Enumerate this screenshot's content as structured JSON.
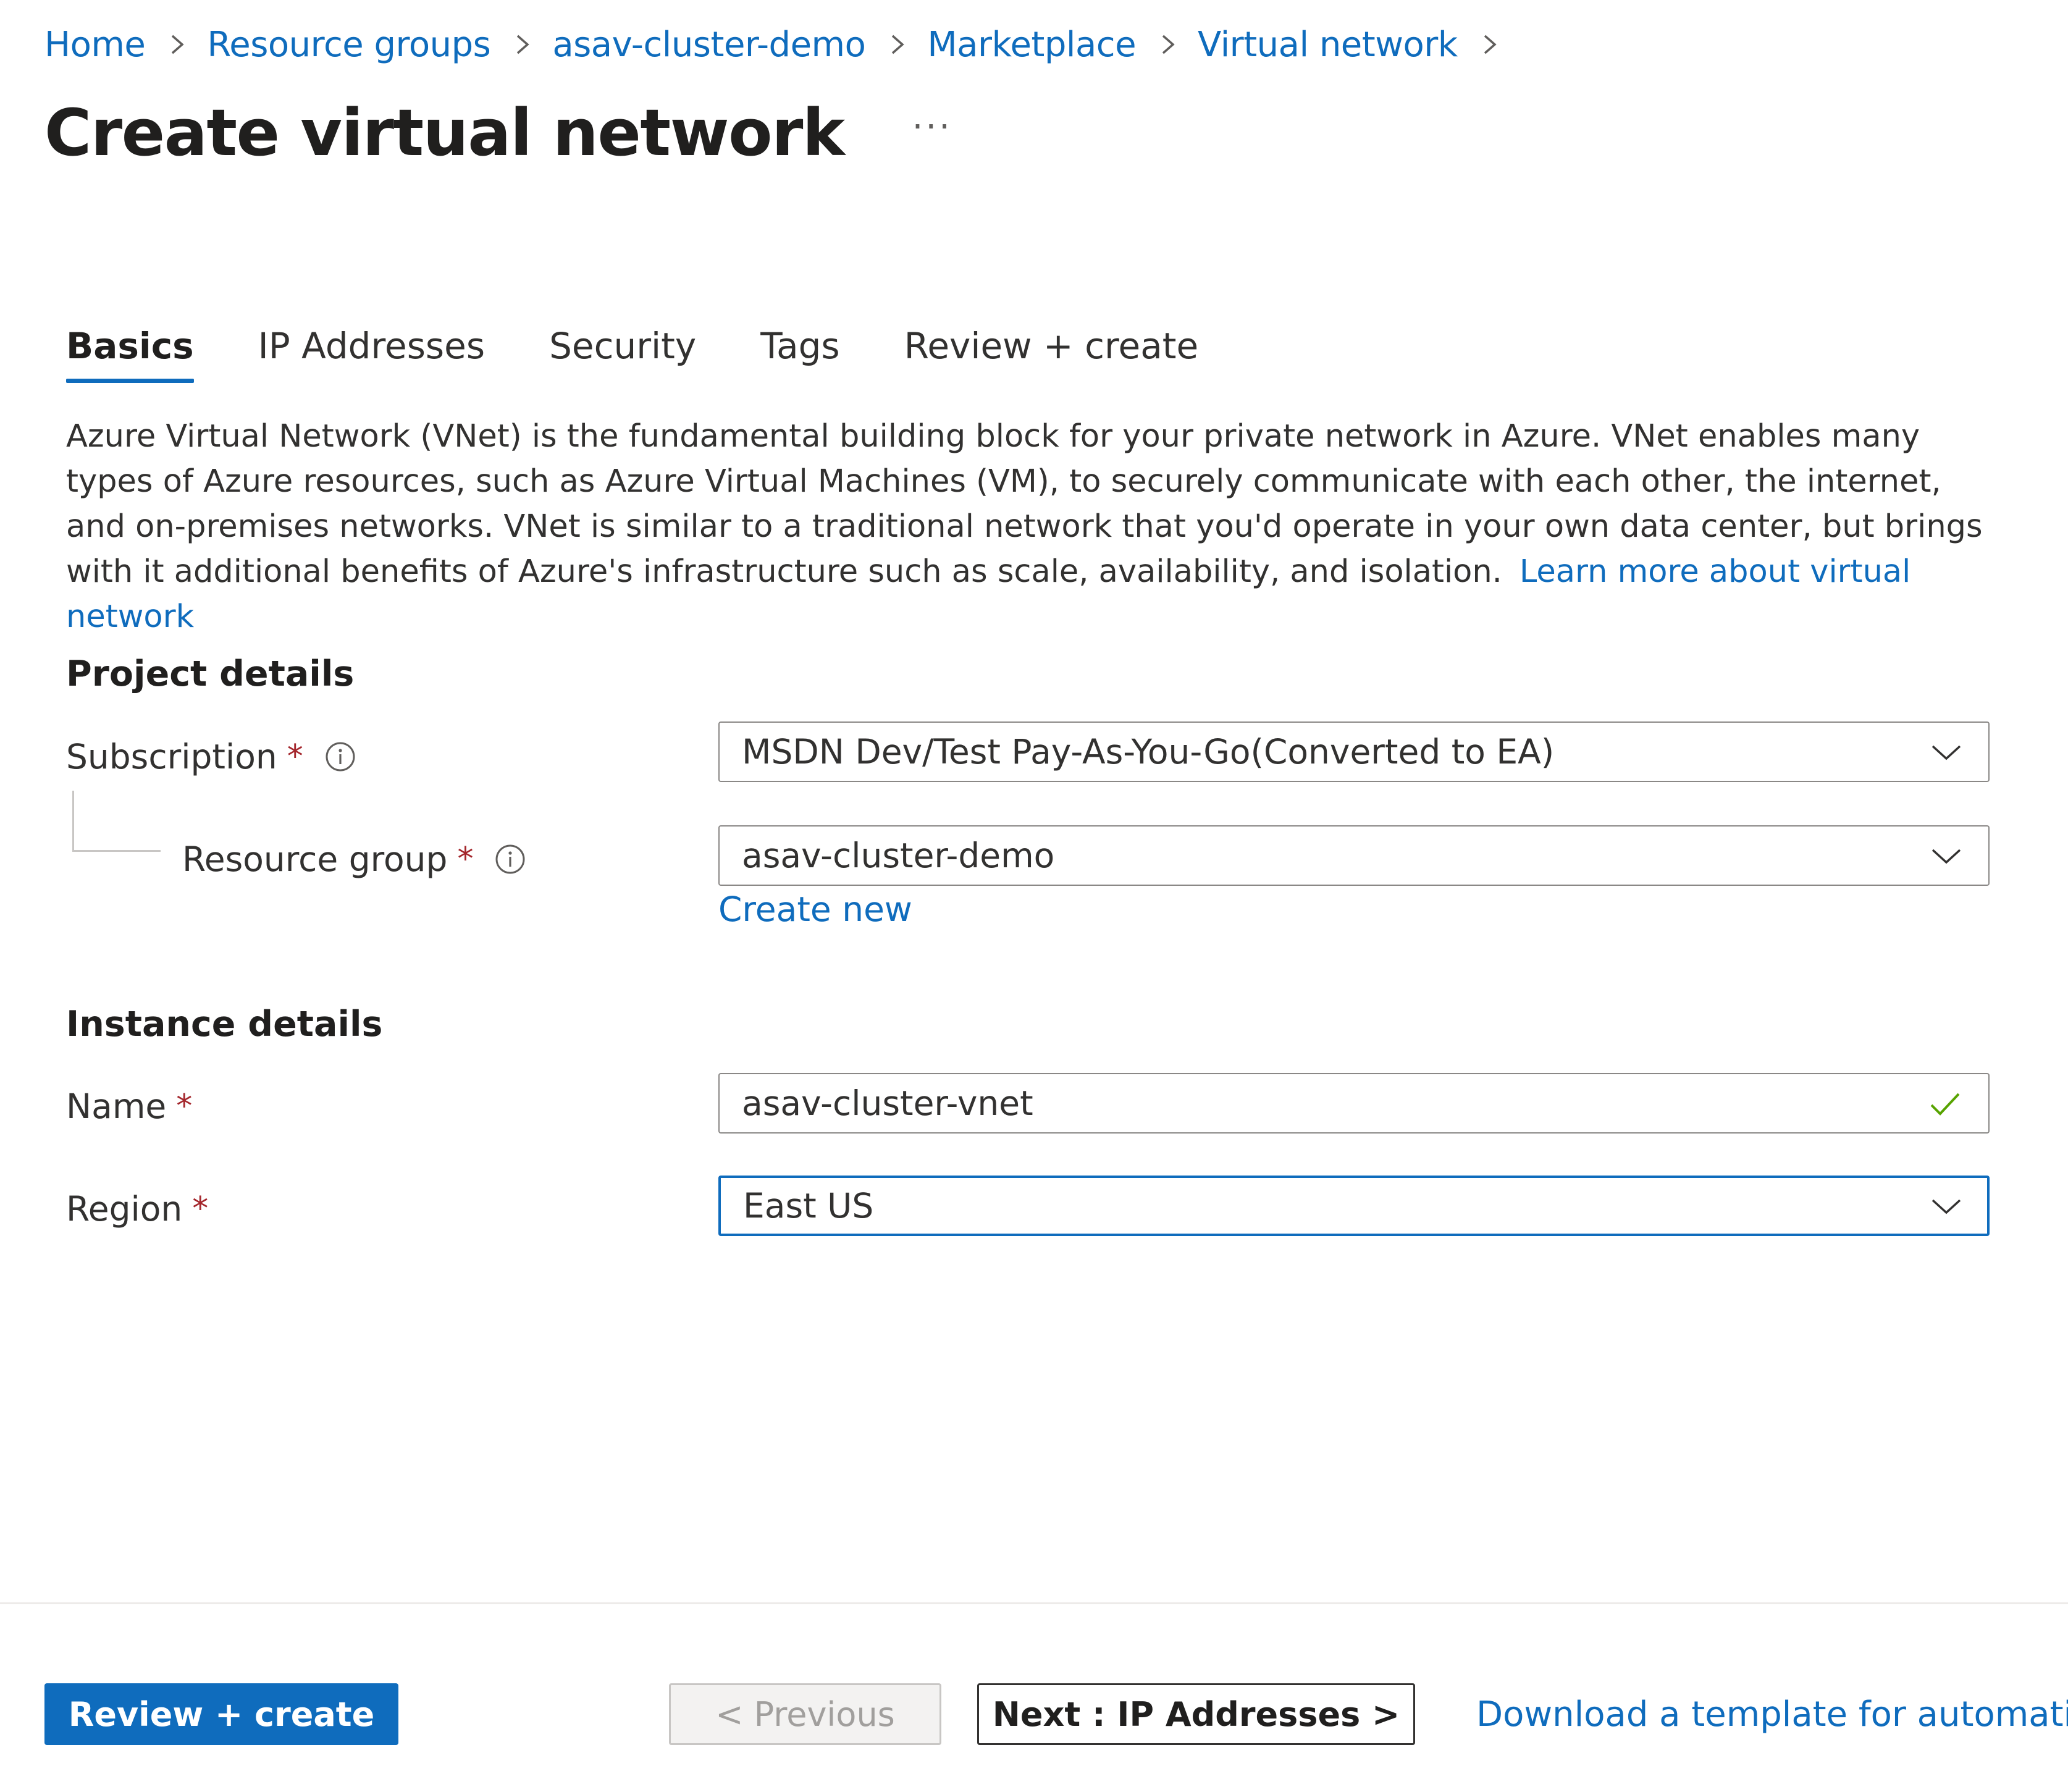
{
  "breadcrumb": {
    "items": [
      "Home",
      "Resource groups",
      "asav-cluster-demo",
      "Marketplace",
      "Virtual network"
    ]
  },
  "header": {
    "title": "Create virtual network",
    "more_label": "···"
  },
  "tabs": [
    {
      "label": "Basics",
      "active": true
    },
    {
      "label": "IP Addresses",
      "active": false
    },
    {
      "label": "Security",
      "active": false
    },
    {
      "label": "Tags",
      "active": false
    },
    {
      "label": "Review + create",
      "active": false
    }
  ],
  "description": {
    "text": "Azure Virtual Network (VNet) is the fundamental building block for your private network in Azure. VNet enables many types of Azure resources, such as Azure Virtual Machines (VM), to securely communicate with each other, the internet, and on-premises networks. VNet is similar to a traditional network that you'd operate in your own data center, but brings with it additional benefits of Azure's infrastructure such as scale, availability, and isolation.",
    "link": "Learn more about virtual network"
  },
  "project_details": {
    "title": "Project details",
    "subscription": {
      "label": "Subscription",
      "required_mark": "*",
      "value": "MSDN Dev/Test Pay-As-You-Go(Converted to EA)"
    },
    "resource_group": {
      "label": "Resource group",
      "required_mark": "*",
      "value": "asav-cluster-demo",
      "create_new": "Create new"
    }
  },
  "instance_details": {
    "title": "Instance details",
    "name": {
      "label": "Name",
      "required_mark": "*",
      "value": "asav-cluster-vnet"
    },
    "region": {
      "label": "Region",
      "required_mark": "*",
      "value": "East US"
    }
  },
  "footer": {
    "review_create": "Review + create",
    "previous": "< Previous",
    "next": "Next : IP Addresses >",
    "download": "Download a template for automation"
  },
  "colors": {
    "accent": "#0f6cbd",
    "required": "#a4262c",
    "valid": "#57a300",
    "text": "#323130"
  },
  "icons": {
    "breadcrumb_separator": "chevron-right-icon",
    "info": "info-icon",
    "dropdown": "chevron-down-icon",
    "valid": "checkmark-icon"
  }
}
